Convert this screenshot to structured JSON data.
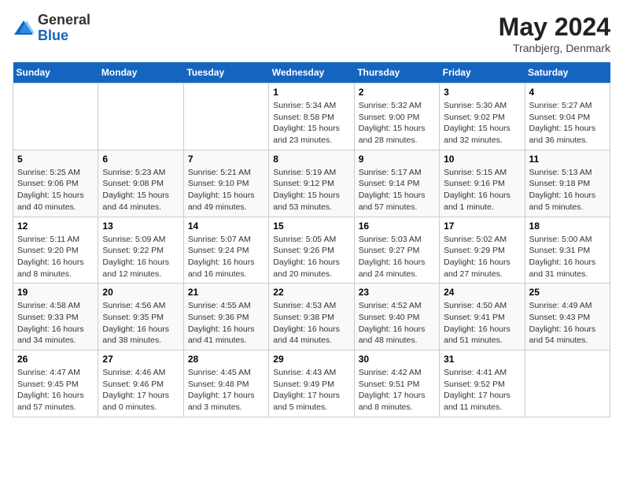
{
  "header": {
    "logo_general": "General",
    "logo_blue": "Blue",
    "month_title": "May 2024",
    "location": "Tranbjerg, Denmark"
  },
  "weekdays": [
    "Sunday",
    "Monday",
    "Tuesday",
    "Wednesday",
    "Thursday",
    "Friday",
    "Saturday"
  ],
  "weeks": [
    [
      {
        "day": "",
        "detail": ""
      },
      {
        "day": "",
        "detail": ""
      },
      {
        "day": "",
        "detail": ""
      },
      {
        "day": "1",
        "detail": "Sunrise: 5:34 AM\nSunset: 8:58 PM\nDaylight: 15 hours\nand 23 minutes."
      },
      {
        "day": "2",
        "detail": "Sunrise: 5:32 AM\nSunset: 9:00 PM\nDaylight: 15 hours\nand 28 minutes."
      },
      {
        "day": "3",
        "detail": "Sunrise: 5:30 AM\nSunset: 9:02 PM\nDaylight: 15 hours\nand 32 minutes."
      },
      {
        "day": "4",
        "detail": "Sunrise: 5:27 AM\nSunset: 9:04 PM\nDaylight: 15 hours\nand 36 minutes."
      }
    ],
    [
      {
        "day": "5",
        "detail": "Sunrise: 5:25 AM\nSunset: 9:06 PM\nDaylight: 15 hours\nand 40 minutes."
      },
      {
        "day": "6",
        "detail": "Sunrise: 5:23 AM\nSunset: 9:08 PM\nDaylight: 15 hours\nand 44 minutes."
      },
      {
        "day": "7",
        "detail": "Sunrise: 5:21 AM\nSunset: 9:10 PM\nDaylight: 15 hours\nand 49 minutes."
      },
      {
        "day": "8",
        "detail": "Sunrise: 5:19 AM\nSunset: 9:12 PM\nDaylight: 15 hours\nand 53 minutes."
      },
      {
        "day": "9",
        "detail": "Sunrise: 5:17 AM\nSunset: 9:14 PM\nDaylight: 15 hours\nand 57 minutes."
      },
      {
        "day": "10",
        "detail": "Sunrise: 5:15 AM\nSunset: 9:16 PM\nDaylight: 16 hours\nand 1 minute."
      },
      {
        "day": "11",
        "detail": "Sunrise: 5:13 AM\nSunset: 9:18 PM\nDaylight: 16 hours\nand 5 minutes."
      }
    ],
    [
      {
        "day": "12",
        "detail": "Sunrise: 5:11 AM\nSunset: 9:20 PM\nDaylight: 16 hours\nand 8 minutes."
      },
      {
        "day": "13",
        "detail": "Sunrise: 5:09 AM\nSunset: 9:22 PM\nDaylight: 16 hours\nand 12 minutes."
      },
      {
        "day": "14",
        "detail": "Sunrise: 5:07 AM\nSunset: 9:24 PM\nDaylight: 16 hours\nand 16 minutes."
      },
      {
        "day": "15",
        "detail": "Sunrise: 5:05 AM\nSunset: 9:26 PM\nDaylight: 16 hours\nand 20 minutes."
      },
      {
        "day": "16",
        "detail": "Sunrise: 5:03 AM\nSunset: 9:27 PM\nDaylight: 16 hours\nand 24 minutes."
      },
      {
        "day": "17",
        "detail": "Sunrise: 5:02 AM\nSunset: 9:29 PM\nDaylight: 16 hours\nand 27 minutes."
      },
      {
        "day": "18",
        "detail": "Sunrise: 5:00 AM\nSunset: 9:31 PM\nDaylight: 16 hours\nand 31 minutes."
      }
    ],
    [
      {
        "day": "19",
        "detail": "Sunrise: 4:58 AM\nSunset: 9:33 PM\nDaylight: 16 hours\nand 34 minutes."
      },
      {
        "day": "20",
        "detail": "Sunrise: 4:56 AM\nSunset: 9:35 PM\nDaylight: 16 hours\nand 38 minutes."
      },
      {
        "day": "21",
        "detail": "Sunrise: 4:55 AM\nSunset: 9:36 PM\nDaylight: 16 hours\nand 41 minutes."
      },
      {
        "day": "22",
        "detail": "Sunrise: 4:53 AM\nSunset: 9:38 PM\nDaylight: 16 hours\nand 44 minutes."
      },
      {
        "day": "23",
        "detail": "Sunrise: 4:52 AM\nSunset: 9:40 PM\nDaylight: 16 hours\nand 48 minutes."
      },
      {
        "day": "24",
        "detail": "Sunrise: 4:50 AM\nSunset: 9:41 PM\nDaylight: 16 hours\nand 51 minutes."
      },
      {
        "day": "25",
        "detail": "Sunrise: 4:49 AM\nSunset: 9:43 PM\nDaylight: 16 hours\nand 54 minutes."
      }
    ],
    [
      {
        "day": "26",
        "detail": "Sunrise: 4:47 AM\nSunset: 9:45 PM\nDaylight: 16 hours\nand 57 minutes."
      },
      {
        "day": "27",
        "detail": "Sunrise: 4:46 AM\nSunset: 9:46 PM\nDaylight: 17 hours\nand 0 minutes."
      },
      {
        "day": "28",
        "detail": "Sunrise: 4:45 AM\nSunset: 9:48 PM\nDaylight: 17 hours\nand 3 minutes."
      },
      {
        "day": "29",
        "detail": "Sunrise: 4:43 AM\nSunset: 9:49 PM\nDaylight: 17 hours\nand 5 minutes."
      },
      {
        "day": "30",
        "detail": "Sunrise: 4:42 AM\nSunset: 9:51 PM\nDaylight: 17 hours\nand 8 minutes."
      },
      {
        "day": "31",
        "detail": "Sunrise: 4:41 AM\nSunset: 9:52 PM\nDaylight: 17 hours\nand 11 minutes."
      },
      {
        "day": "",
        "detail": ""
      }
    ]
  ]
}
